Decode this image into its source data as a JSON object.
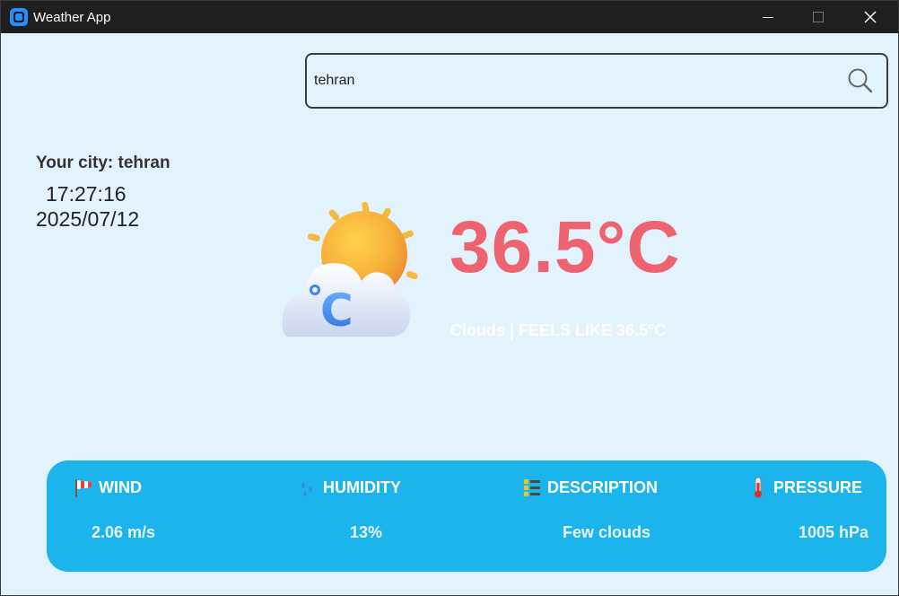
{
  "window": {
    "title": "Weather App"
  },
  "search": {
    "value": "tehran",
    "placeholder": ""
  },
  "city": {
    "label": "Your city: tehran",
    "time": "17:27:16",
    "date": "2025/07/12"
  },
  "current": {
    "icon": "sun-cloud-celsius-icon",
    "temperature": "36.5°C",
    "summary": "Clouds | FEELS LIKE 36.5°C"
  },
  "details": [
    {
      "icon": "windsock-icon",
      "title": "WIND",
      "value": "2.06 m/s"
    },
    {
      "icon": "droplets-icon",
      "title": "HUMIDITY",
      "value": "13%"
    },
    {
      "icon": "list-icon",
      "title": "DESCRIPTION",
      "value": "Few clouds"
    },
    {
      "icon": "thermometer-icon",
      "title": "PRESSURE",
      "value": "1005 hPa"
    }
  ],
  "colors": {
    "background": "#e3f3fd",
    "temperature": "#ed6470",
    "panel": "#1bb4ec",
    "titlebar": "#1f1f1f"
  }
}
